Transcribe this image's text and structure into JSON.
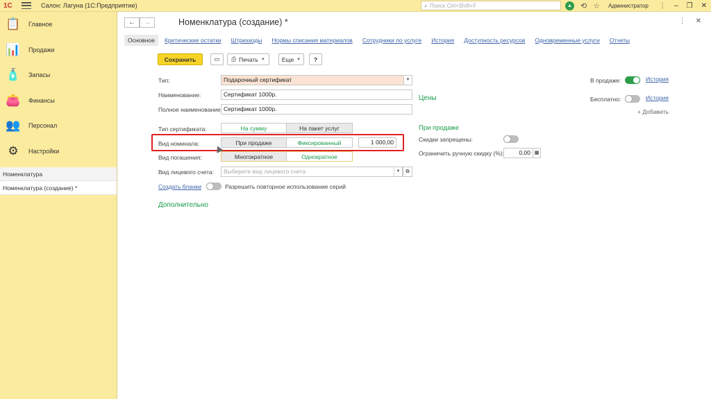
{
  "titlebar": {
    "logo": "1С",
    "title": "Салон: Лагуна  (1С:Предприятие)",
    "search_placeholder": "Поиск Ctrl+Shift+F",
    "user": "Администратор"
  },
  "sidebar": {
    "items": [
      {
        "label": "Главное",
        "icon": "clipboard-icon",
        "glyph": "📋"
      },
      {
        "label": "Продажи",
        "icon": "sales-chart-icon",
        "glyph": "📊"
      },
      {
        "label": "Запасы",
        "icon": "bottle-icon",
        "glyph": "🧴"
      },
      {
        "label": "Финансы",
        "icon": "wallet-icon",
        "glyph": "👛"
      },
      {
        "label": "Персонал",
        "icon": "people-icon",
        "glyph": "👥"
      },
      {
        "label": "Настройки",
        "icon": "gear-icon",
        "glyph": "⚙"
      }
    ],
    "open_windows": [
      "Номенклатура",
      "Номенклатура (создание) *"
    ]
  },
  "form": {
    "title": "Номенклатура (создание) *",
    "tabs": [
      "Основное",
      "Критические остатки",
      "Штрихкоды",
      "Нормы списания материалов",
      "Сотрудники по услуге",
      "История",
      "Доступность ресурсов",
      "Одновременные услуги",
      "Отчеты"
    ],
    "toolbar": {
      "save": "Сохранить",
      "print": "Печать",
      "more": "Еще",
      "help": "?"
    },
    "fields": {
      "type_label": "Тип:",
      "type_value": "Подарочный сертификат",
      "name_label": "Наименование:",
      "name_value": "Сертификат 1000р.",
      "fullname_label": "Полное наименование:",
      "fullname_value": "Сертификат 1000р.",
      "cert_type_label": "Тип сертификата:",
      "cert_type_options": [
        "На сумму",
        "На пакет услуг"
      ],
      "nominal_label": "Вид номинала:",
      "nominal_options": [
        "При продаже",
        "Фиксированный"
      ],
      "nominal_value": "1 000,00",
      "redemption_label": "Вид погашения:",
      "redemption_options": [
        "Многократное",
        "Однократное"
      ],
      "account_label": "Вид лицевого счета:",
      "account_placeholder": "Выберите вид лицевого счета",
      "create_forms_link": "Создать бланки",
      "reuse_series_label": "Разрешить повторное использование серий",
      "additional_section": "Дополнительно"
    },
    "right": {
      "on_sale_label": "В продаже:",
      "on_sale_history": "История",
      "free_label": "Бесплатно:",
      "free_history": "История",
      "add_link": "+ Добавить",
      "prices_section": "Цены",
      "at_sale_section": "При продаже",
      "discounts_forbidden_label": "Скидки запрещены:",
      "manual_discount_label": "Ограничить ручную скидку (%):",
      "manual_discount_value": "0,00"
    }
  }
}
